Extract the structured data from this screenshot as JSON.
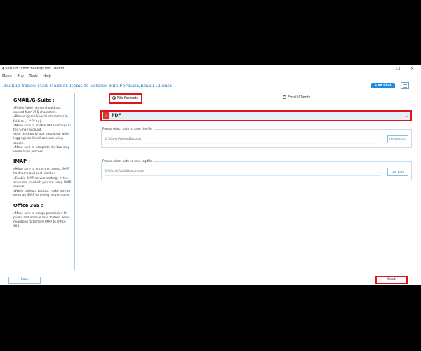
{
  "window": {
    "title": "SysInfo Yahoo Backup Tool (Demo)",
    "minimize": "–",
    "restore": "❐",
    "close": "✕"
  },
  "menu": [
    "Menu",
    "Buy",
    "Tools",
    "Help"
  ],
  "heading": "Backup Yahoo Mail Mailbox Items to Various File Formats/Email Clients",
  "live_chat": "Live Chat",
  "sidebar": {
    "sections": [
      {
        "title": "GMAIL/G-Suite :",
        "items": [
          "»Folder/label names should not exceed from 255 characters.",
          "»Please ignore Special characters in folders \\ / ,* ?\"<>|.",
          "»Make sure to enable IMAP settings in the Gmail account.",
          "»Use third-party app password, while logging into Gmail account using source.",
          "»Make sure to complete the two-step verification process."
        ]
      },
      {
        "title": "IMAP :",
        "items": [
          "»Make sure to enter the correct IMAP hostname and port number.",
          "»Enable IMAP service settings in the accounts, in which you are using IMAP service.",
          "»While taking a backup, make sure to enter an IMAP incoming server name."
        ]
      },
      {
        "title": "Office 365 :",
        "items": [
          "»Make sure to assign permission for public and archive mail folders, while migrating data from IMAP to Office 365."
        ]
      }
    ]
  },
  "options": {
    "file_formats": "File Formats",
    "email_clients": "Email Clients",
    "selected": "File Formats"
  },
  "format_select": {
    "value": "PDF",
    "icon": "pdf-icon"
  },
  "save_path": {
    "label": "Please select path to save the file",
    "value": "C:\\Users\\Admin\\Desktop",
    "button": "Destination"
  },
  "log_path": {
    "label": "Please select path to save log file",
    "value": "C:\\Users\\Rohit\\Documents",
    "button": "Log path"
  },
  "footer": {
    "back": "Back",
    "next": "Next"
  }
}
